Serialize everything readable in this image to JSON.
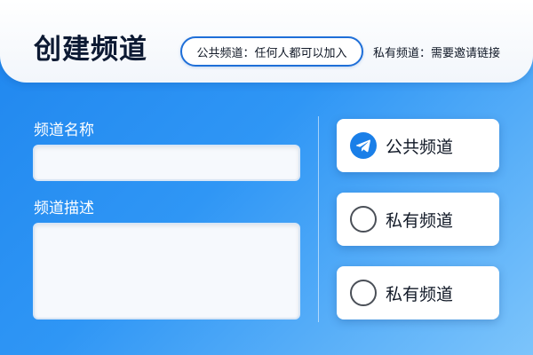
{
  "header": {
    "title": "创建频道",
    "public_note": "公共频道：任何人都可以加入",
    "private_note": "私有频道：需要邀请链接"
  },
  "form": {
    "name_label": "频道名称",
    "name_value": "",
    "description_label": "频道描述",
    "description_value": ""
  },
  "options": [
    {
      "label": "公共频道",
      "selected": true,
      "icon": "telegram-plane-icon"
    },
    {
      "label": "私有频道",
      "selected": false,
      "icon": "radio-empty-icon"
    },
    {
      "label": "私有频道",
      "selected": false,
      "icon": "radio-empty-icon"
    }
  ],
  "colors": {
    "accent": "#1f6fd8",
    "selected_icon": "#1a7fe8",
    "background_top": "#1f86ee",
    "background_bottom": "#7cc4fb"
  }
}
